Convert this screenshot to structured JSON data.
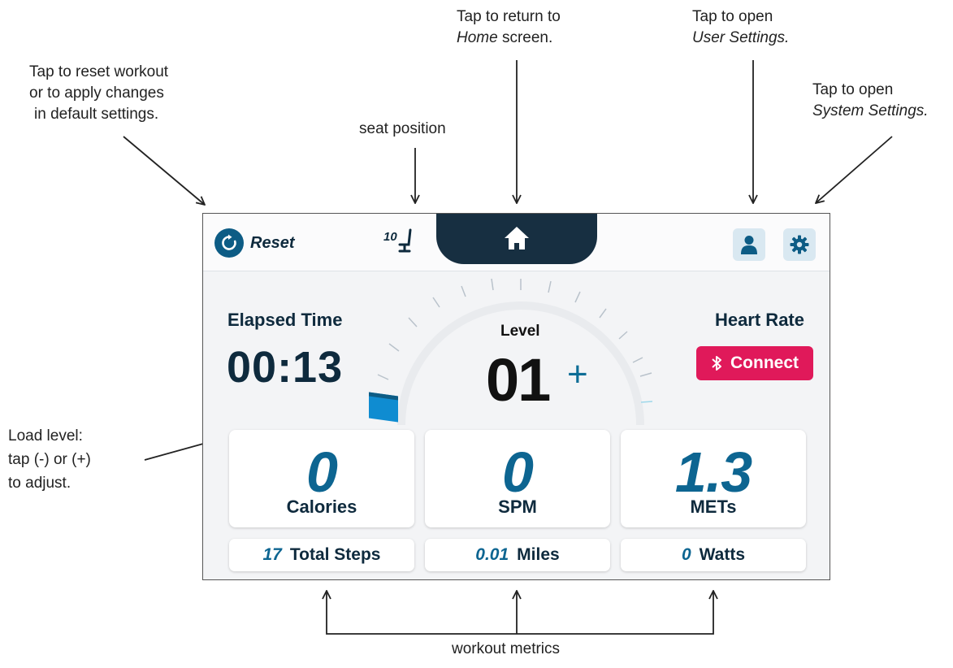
{
  "callouts": {
    "reset": [
      "Tap to reset workout",
      "or to apply changes",
      "in default settings."
    ],
    "seat": "seat position",
    "home": [
      "Tap to return to",
      "Home",
      "screen."
    ],
    "user": [
      "Tap to open",
      "User Settings."
    ],
    "system": [
      "Tap to open",
      "System Settings."
    ],
    "load": [
      "Load level:",
      "tap (-) or (+)",
      "to adjust."
    ],
    "metrics": "workout metrics"
  },
  "topbar": {
    "reset_label": "Reset",
    "seat_position": "10",
    "icons": [
      "reset-icon",
      "seat-icon",
      "home-icon",
      "user-icon",
      "gear-icon"
    ]
  },
  "elapsed": {
    "label": "Elapsed Time",
    "value": "00:13"
  },
  "level": {
    "label": "Level",
    "value": "01",
    "plus": "+"
  },
  "heart_rate": {
    "label": "Heart Rate",
    "connect_label": "Connect",
    "icon": "bluetooth-icon"
  },
  "metrics": [
    {
      "value": "0",
      "label": "Calories"
    },
    {
      "value": "0",
      "label": "SPM"
    },
    {
      "value": "1.3",
      "label": "METs"
    }
  ],
  "secondary_metrics": [
    {
      "value": "17",
      "label": "Total Steps"
    },
    {
      "value": "0.01",
      "label": "Miles"
    },
    {
      "value": "0",
      "label": "Watts"
    }
  ],
  "colors": {
    "accent_blue": "#0d6591",
    "dark_navy": "#172f41",
    "connect_pink": "#e0195a",
    "load_marker": "#0f8cd1"
  }
}
